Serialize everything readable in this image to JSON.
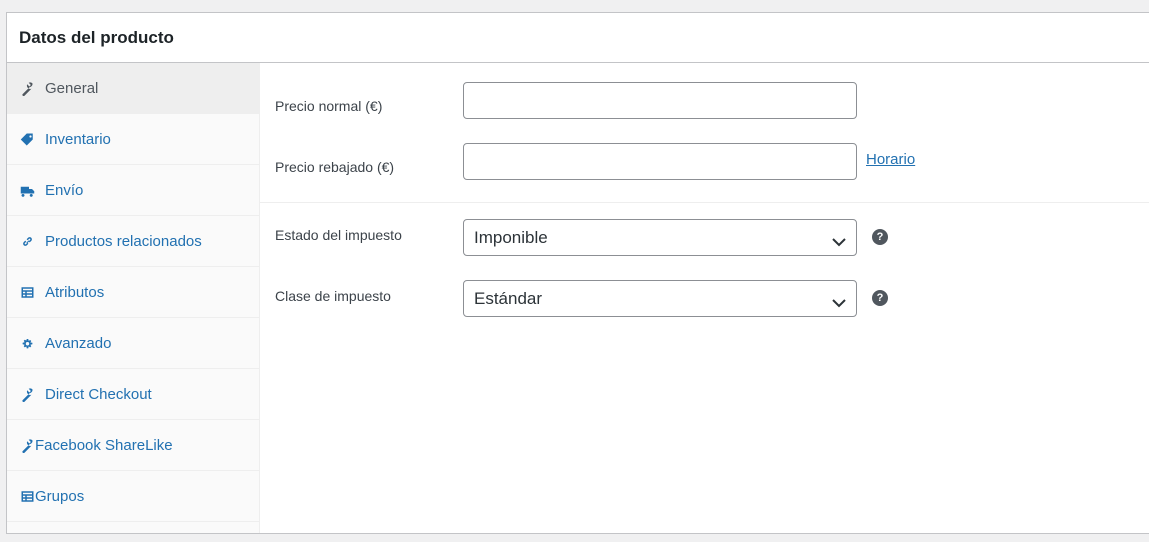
{
  "panel": {
    "title": "Datos del producto"
  },
  "tabs": [
    {
      "label": "General",
      "icon": "wrench-icon",
      "active": true
    },
    {
      "label": "Inventario",
      "icon": "tag-icon"
    },
    {
      "label": "Envío",
      "icon": "truck-icon"
    },
    {
      "label": "Productos relacionados",
      "icon": "link-icon"
    },
    {
      "label": "Atributos",
      "icon": "list-table-icon"
    },
    {
      "label": "Avanzado",
      "icon": "gear-icon"
    },
    {
      "label": "Direct Checkout",
      "icon": "wrench-icon"
    },
    {
      "label": "Facebook ShareLike",
      "icon": "wrench-icon"
    },
    {
      "label": "Grupos",
      "icon": "list-table-icon"
    }
  ],
  "pricing": {
    "regular_price_label": "Precio normal (€)",
    "regular_price_value": "",
    "sale_price_label": "Precio rebajado (€)",
    "sale_price_value": "",
    "schedule_link": "Horario"
  },
  "tax": {
    "status_label": "Estado del impuesto",
    "status_value": "Imponible",
    "class_label": "Clase de impuesto",
    "class_value": "Estándar",
    "help_icon": "question-circle-icon"
  },
  "colors": {
    "link": "#2271b1",
    "active_tab_bg": "#eeeeee",
    "border": "#c3c4c7"
  }
}
